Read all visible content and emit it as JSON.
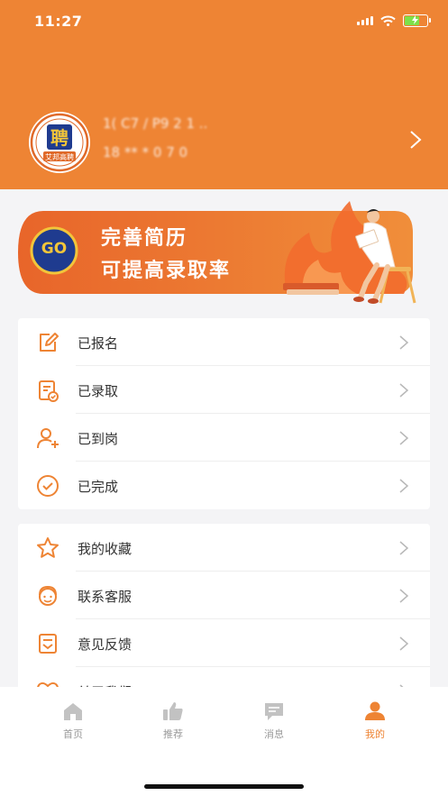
{
  "status_bar": {
    "time": "11:27"
  },
  "profile": {
    "logo_text": "聘",
    "logo_caption": "艾邦高聘",
    "name": "1( C7 / P9 2 1 ..",
    "phone": "18 ** * 0 7 0"
  },
  "banner": {
    "go_label": "GO",
    "line1": "完善简历",
    "line2": "可提高录取率"
  },
  "status_menu": [
    {
      "label": "已报名",
      "icon": "edit-icon"
    },
    {
      "label": "已录取",
      "icon": "document-check-icon"
    },
    {
      "label": "已到岗",
      "icon": "user-add-icon"
    },
    {
      "label": "已完成",
      "icon": "check-circle-icon"
    }
  ],
  "more_menu": [
    {
      "label": "我的收藏",
      "icon": "star-icon"
    },
    {
      "label": "联系客服",
      "icon": "customer-service-icon"
    },
    {
      "label": "意见反馈",
      "icon": "feedback-icon"
    },
    {
      "label": "关于我们",
      "icon": "heart-icon"
    }
  ],
  "tab_bar": [
    {
      "label": "首页",
      "icon": "home-icon",
      "active": false
    },
    {
      "label": "推荐",
      "icon": "thumbs-up-icon",
      "active": false
    },
    {
      "label": "消息",
      "icon": "message-icon",
      "active": false
    },
    {
      "label": "我的",
      "icon": "person-icon",
      "active": true
    }
  ],
  "colors": {
    "accent": "#ee8434",
    "navy": "#1f3b8f",
    "gold": "#f2c53a"
  }
}
